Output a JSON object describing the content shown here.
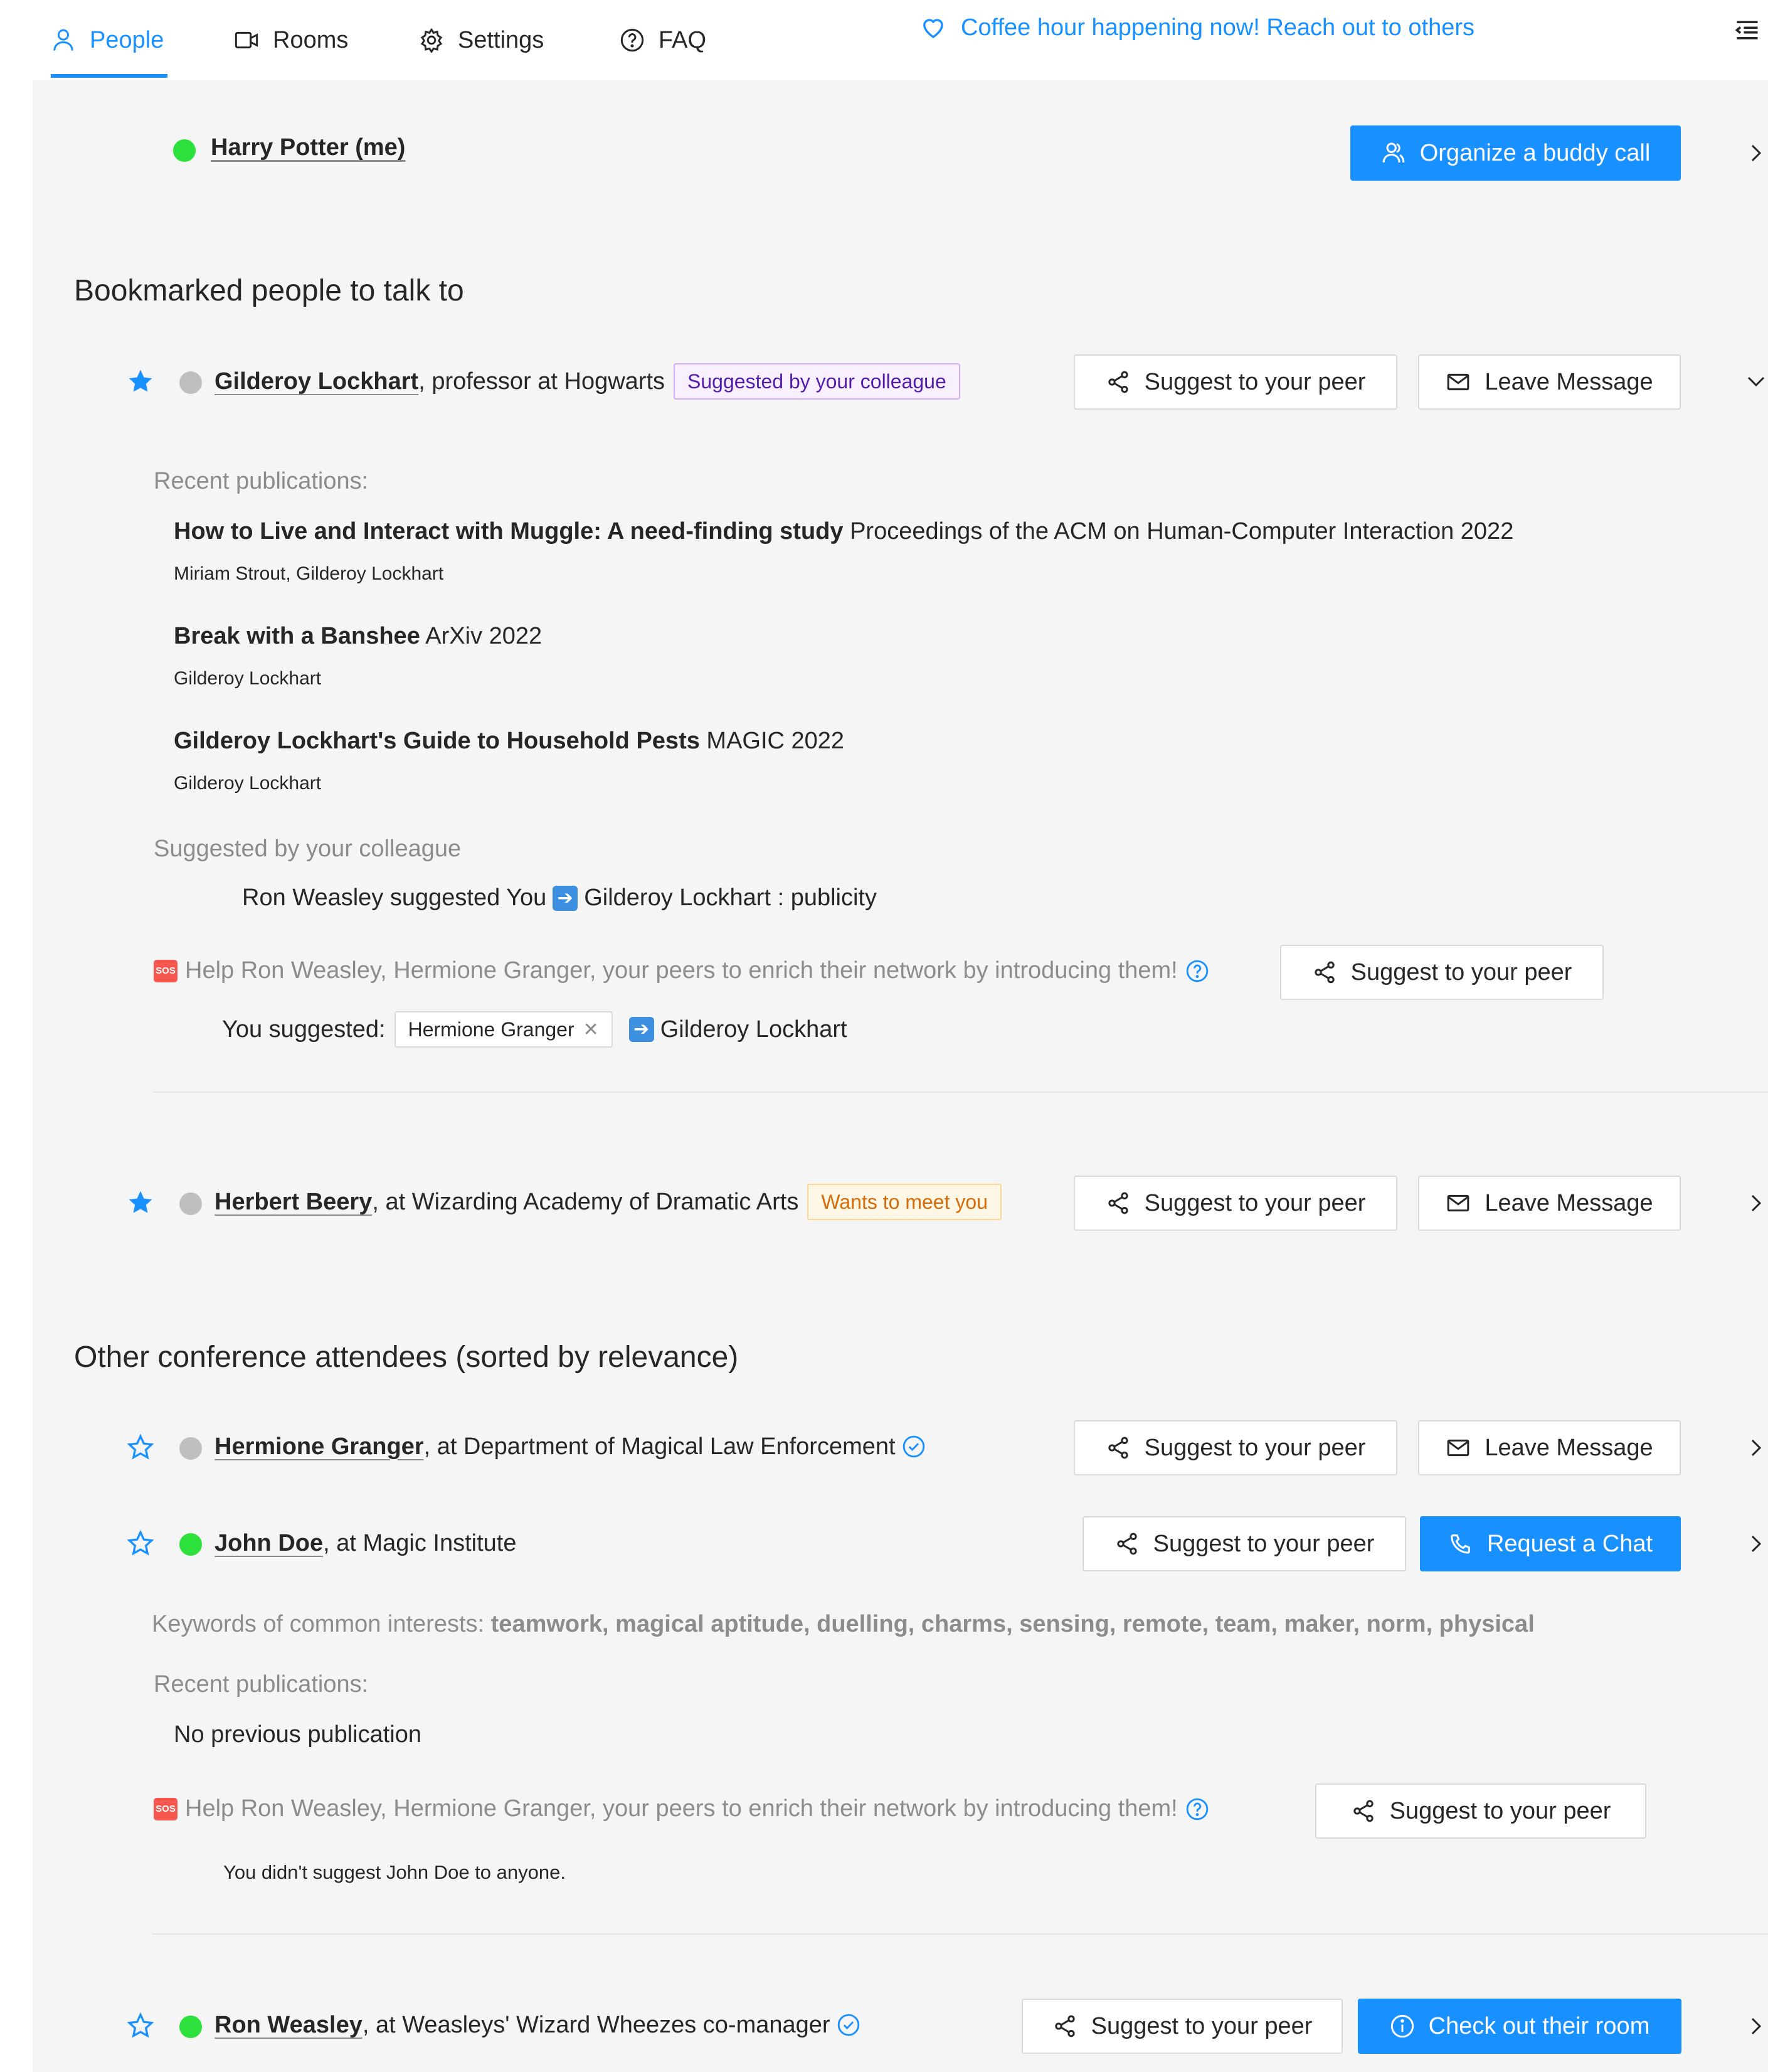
{
  "nav": {
    "tabs": [
      {
        "label": "People",
        "icon": "user-icon",
        "active": true
      },
      {
        "label": "Rooms",
        "icon": "video-icon",
        "active": false
      },
      {
        "label": "Settings",
        "icon": "gear-icon",
        "active": false
      },
      {
        "label": "FAQ",
        "icon": "question-circle-icon",
        "active": false
      }
    ],
    "banner": "Coffee hour happening now! Reach out to others"
  },
  "me": {
    "name": "Harry Potter (me)",
    "buddy_button": "Organize a buddy call"
  },
  "bookmarked": {
    "title": "Bookmarked people to talk to",
    "people": [
      {
        "name": "Gilderoy Lockhart",
        "affiliation": ", professor at Hogwarts",
        "tag": "Suggested by your colleague",
        "suggest_button": "Suggest to your peer",
        "message_button": "Leave Message",
        "recent_pub_label": "Recent publications:",
        "publications": [
          {
            "title": "How to Live and Interact with Muggle: A need-finding study",
            "venue": " Proceedings of the ACM on Human-Computer Interaction 2022",
            "authors": "Miriam Strout, Gilderoy Lockhart"
          },
          {
            "title": "Break with a Banshee",
            "venue": " ArXiv 2022",
            "authors": "Gilderoy Lockhart"
          },
          {
            "title": "Gilderoy Lockhart's Guide to Household Pests",
            "venue": " MAGIC 2022",
            "authors": "Gilderoy Lockhart"
          }
        ],
        "suggested_label": "Suggested by your colleague",
        "suggestion": {
          "from": "Ron Weasley suggested You",
          "to": "Gilderoy Lockhart : publicity"
        },
        "help_text": "Help Ron Weasley, Hermione Granger, your peers to enrich their network by introducing them!",
        "help_button": "Suggest to your peer",
        "you_suggested_label": "You suggested:",
        "you_suggested_tag": "Hermione Granger",
        "you_suggested_target": "Gilderoy Lockhart"
      },
      {
        "name": "Herbert Beery",
        "affiliation": ", at Wizarding Academy of Dramatic Arts",
        "tag": "Wants to meet you",
        "suggest_button": "Suggest to your peer",
        "message_button": "Leave Message"
      }
    ]
  },
  "others": {
    "title": "Other conference attendees (sorted by relevance)",
    "people": [
      {
        "name": "Hermione Granger",
        "affiliation": ", at Department of Magical Law Enforcement",
        "suggest_button": "Suggest to your peer",
        "action_button": "Leave Message"
      },
      {
        "name": "John Doe",
        "affiliation": ", at Magic Institute",
        "suggest_button": "Suggest to your peer",
        "action_button": "Request a Chat",
        "keywords_label": "Keywords of common interests: ",
        "keywords": "teamwork, magical aptitude, duelling, charms, sensing, remote, team, maker, norm, physical",
        "recent_pub_label": "Recent publications:",
        "no_pub": "No previous publication",
        "help_text": "Help Ron Weasley, Hermione Granger, your peers to enrich their network by introducing them!",
        "help_button": "Suggest to your peer",
        "not_suggested": "You didn't suggest John Doe to anyone."
      },
      {
        "name": "Ron Weasley",
        "affiliation": ", at Weasleys' Wizard Wheezes co-manager",
        "suggest_button": "Suggest to your peer",
        "action_button": "Check out their room"
      }
    ]
  },
  "colors": {
    "accent": "#1890ff",
    "online": "#2de03c",
    "offline": "#bfbfbf",
    "purple_tag": "#531dab",
    "orange_tag": "#d46b08"
  }
}
